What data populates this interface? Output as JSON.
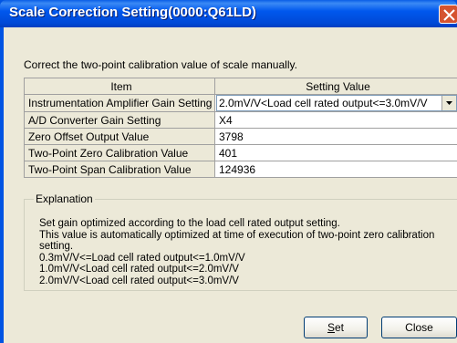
{
  "window": {
    "title": "Scale Correction Setting(0000:Q61LD)"
  },
  "description": "Correct the two-point calibration value of scale manually.",
  "table": {
    "headers": [
      "Item",
      "Setting Value"
    ],
    "rows": [
      {
        "item": "Instrumentation Amplifier Gain Setting",
        "value": "2.0mV/V<Load cell rated output<=3.0mV/V"
      },
      {
        "item": "A/D Converter Gain Setting",
        "value": "X4"
      },
      {
        "item": "Zero Offset Output Value",
        "value": "3798"
      },
      {
        "item": "Two-Point Zero Calibration Value",
        "value": "401"
      },
      {
        "item": "Two-Point Span Calibration Value",
        "value": "124936"
      }
    ]
  },
  "explanation": {
    "legend": "Explanation",
    "lines": [
      "Set gain optimized according to the load cell rated output setting.",
      "This value is automatically optimized at time of execution of two-point zero calibration",
      "setting.",
      "0.3mV/V<=Load cell rated output<=1.0mV/V",
      "1.0mV/V<Load cell rated output<=2.0mV/V",
      "2.0mV/V<Load cell rated output<=3.0mV/V"
    ]
  },
  "buttons": {
    "set_label": "Set",
    "close_label": "Close"
  },
  "icons": {
    "close": "close-icon",
    "dropdown": "chevron-down-icon"
  }
}
